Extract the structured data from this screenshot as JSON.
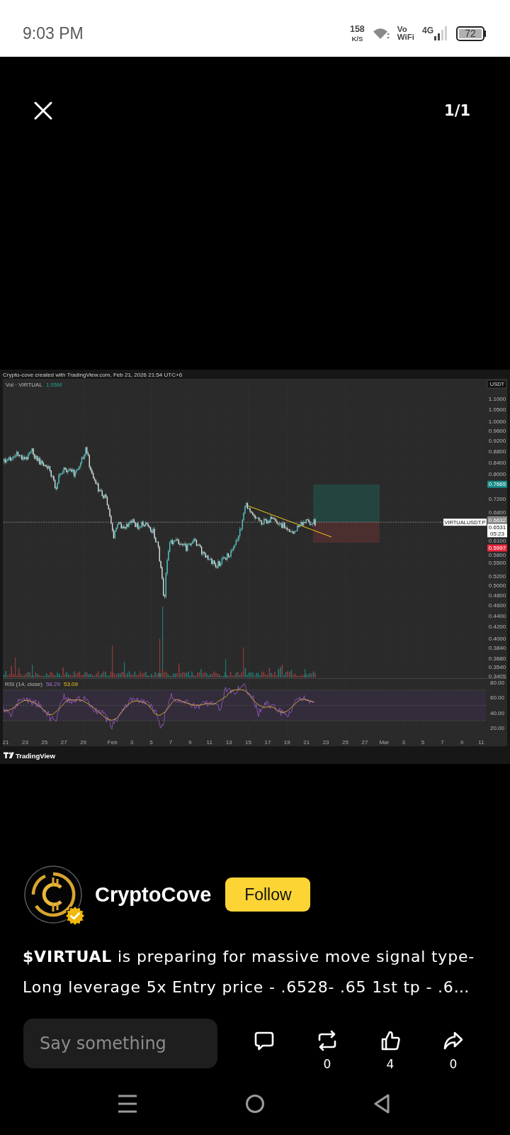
{
  "status_bar": {
    "time": "9:03 PM",
    "speed": "158",
    "speed_unit": "K/S",
    "vowifi": [
      "Vo",
      "WiFi"
    ],
    "network": "4G",
    "battery": "72"
  },
  "viewer": {
    "counter": "1/1"
  },
  "chart_image": {
    "caption": "Crypto-cove created with TradingView.com, Feb 21, 2026 21:54 UTC+6",
    "volume_legend": {
      "label": "Vol · VIRTUAL",
      "value": "1.05M"
    },
    "currency": "USDT",
    "price_axis": [
      "1.1000",
      "1.0500",
      "1.0000",
      "0.9600",
      "0.9200",
      "0.8800",
      "0.8400",
      "0.8000",
      "0.7200",
      "0.6800",
      "0.6100",
      "0.5800",
      "0.5500",
      "0.5200",
      "0.5000",
      "0.4800",
      "0.4600",
      "0.4400",
      "0.4200",
      "0.4000",
      "0.3840",
      "0.3680",
      "0.3540",
      "0.3405"
    ],
    "price_tags": [
      {
        "text": "0.7665",
        "color": "#178a86"
      },
      {
        "text": "0.6632",
        "color": "#8a8a8a"
      },
      {
        "text": "0.5997",
        "color": "#e8293d"
      }
    ],
    "last_price": {
      "symbol": "VIRTUALUSDT.P",
      "price": "0.6531",
      "countdown": "05:23"
    },
    "rsi_legend": {
      "label": "RSI (14, close)",
      "value": "58.29",
      "average": "53.09"
    },
    "rsi_axis": [
      "80.00",
      "60.00",
      "40.00",
      "20.00"
    ],
    "time_axis": [
      "21",
      "23",
      "25",
      "27",
      "29",
      "Feb",
      "3",
      "5",
      "7",
      "9",
      "11",
      "13",
      "15",
      "17",
      "19",
      "21",
      "23",
      "25",
      "27",
      "Mar",
      "3",
      "5",
      "7",
      "9",
      "11"
    ],
    "brand": "TradingView"
  },
  "post": {
    "author": "CryptoCove",
    "verified": true,
    "follow_label": "Follow",
    "text": "**$VIRTUAL** is preparing for massive move signal type- Long leverage 5x Entry price - .6528- .65 1st tp - .6…"
  },
  "actions": {
    "placeholder": "Say something",
    "buttons": [
      {
        "kind": "comment"
      },
      {
        "kind": "repost",
        "count": "0"
      },
      {
        "kind": "like",
        "count": "4"
      },
      {
        "kind": "share",
        "count": "0"
      }
    ]
  }
}
